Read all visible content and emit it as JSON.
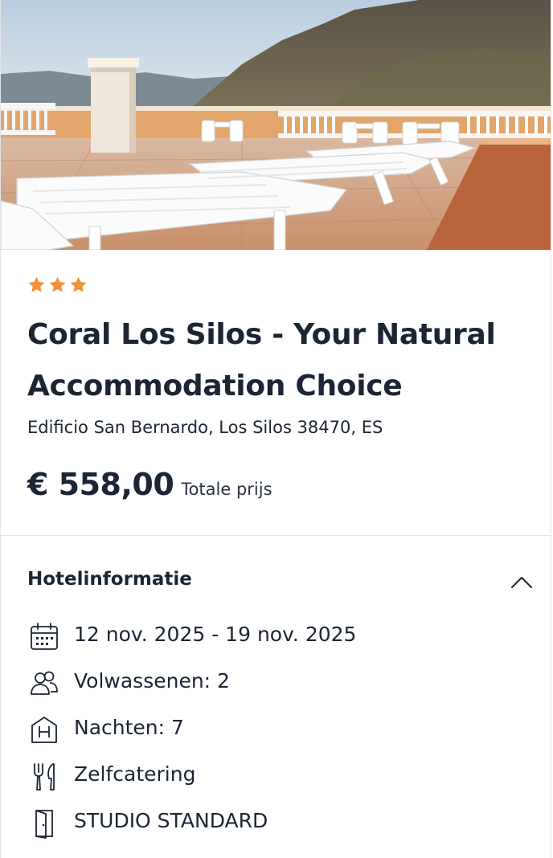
{
  "hotel": {
    "star_rating": 3,
    "star_color": "#f0913a",
    "name": "Coral Los Silos - Your Natural Accommodation Choice",
    "address": "Edificio San Bernardo, Los Silos 38470, ES",
    "price": "€ 558,00",
    "price_label": "Totale prijs",
    "photo_description": "rooftop-terrace-with-white-sun-loungers-and-mountains"
  },
  "info_section": {
    "title": "Hotelinformatie",
    "toggle_icon": "chevron-up-icon",
    "items": [
      {
        "icon": "calendar-icon",
        "text": "12 nov. 2025 - 19 nov. 2025"
      },
      {
        "icon": "people-icon",
        "text": "Volwassenen: 2"
      },
      {
        "icon": "hotel-h-icon",
        "text": "Nachten: 7"
      },
      {
        "icon": "cutlery-icon",
        "text": "Zelfcatering"
      },
      {
        "icon": "door-icon",
        "text": "STUDIO STANDARD"
      }
    ]
  }
}
